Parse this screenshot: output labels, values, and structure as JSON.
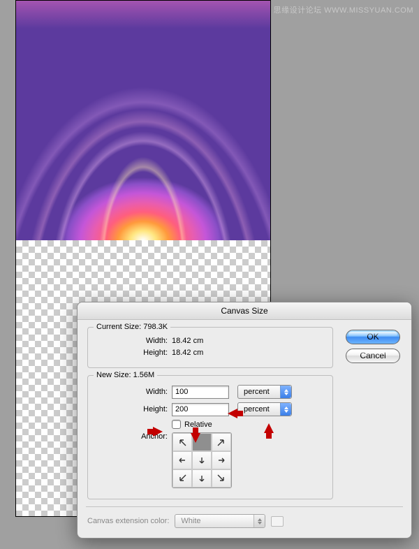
{
  "watermark": "思缘设计论坛 WWW.MISSYUAN.COM",
  "dialog": {
    "title": "Canvas Size",
    "current": {
      "legend": "Current Size:",
      "size": "798.3K",
      "width_label": "Width:",
      "width_value": "18.42 cm",
      "height_label": "Height:",
      "height_value": "18.42 cm"
    },
    "new": {
      "legend": "New Size:",
      "size": "1.56M",
      "width_label": "Width:",
      "width_value": "100",
      "width_unit": "percent",
      "height_label": "Height:",
      "height_value": "200",
      "height_unit": "percent",
      "relative_label": "Relative",
      "relative_checked": false,
      "anchor_label": "Anchor:",
      "anchor_position": "top-center"
    },
    "extension": {
      "label": "Canvas extension color:",
      "value": "White"
    },
    "buttons": {
      "ok": "OK",
      "cancel": "Cancel"
    }
  }
}
